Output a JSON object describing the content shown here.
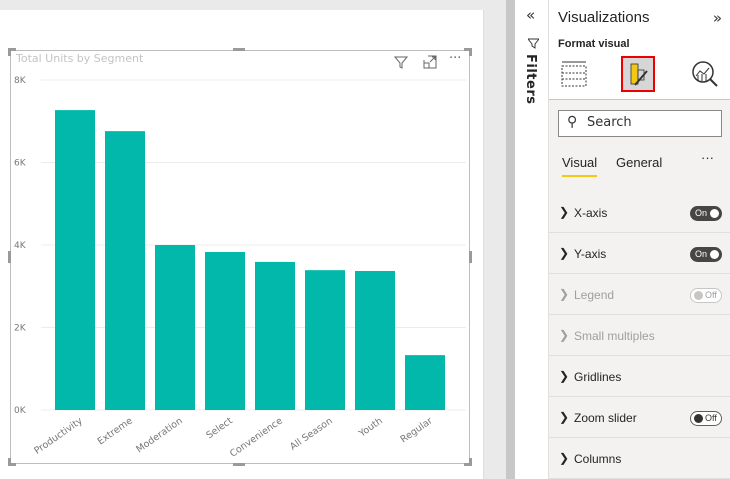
{
  "visual": {
    "title": "Total Units by Segment",
    "icons": [
      "filter-icon",
      "focus-mode-icon",
      "more-options-icon"
    ]
  },
  "chart_data": {
    "type": "bar",
    "title": "Total Units by Segment",
    "categories": [
      "Productivity",
      "Extreme",
      "Moderation",
      "Select",
      "Convenience",
      "All Season",
      "Youth",
      "Regular"
    ],
    "values": [
      7270,
      6760,
      4000,
      3830,
      3590,
      3390,
      3370,
      1330
    ],
    "yticks": [
      "0K",
      "2K",
      "4K",
      "6K",
      "8K"
    ],
    "ylim": [
      0,
      8000
    ],
    "grid": true,
    "color": "#01b8aa"
  },
  "filters": {
    "label": "Filters"
  },
  "viz": {
    "title": "Visualizations",
    "subtitle": "Format visual",
    "search_placeholder": "Search",
    "tabs": {
      "visual": "Visual",
      "general": "General",
      "more": "···"
    },
    "sections": [
      {
        "label": "X-axis",
        "toggle": "On",
        "disabled": false
      },
      {
        "label": "Y-axis",
        "toggle": "On",
        "disabled": false
      },
      {
        "label": "Legend",
        "toggle": "Off",
        "disabled": true
      },
      {
        "label": "Small multiples",
        "toggle": null,
        "disabled": true
      },
      {
        "label": "Gridlines",
        "toggle": null,
        "disabled": false
      },
      {
        "label": "Zoom slider",
        "toggle": "Off",
        "disabled": false
      },
      {
        "label": "Columns",
        "toggle": null,
        "disabled": false
      }
    ]
  }
}
